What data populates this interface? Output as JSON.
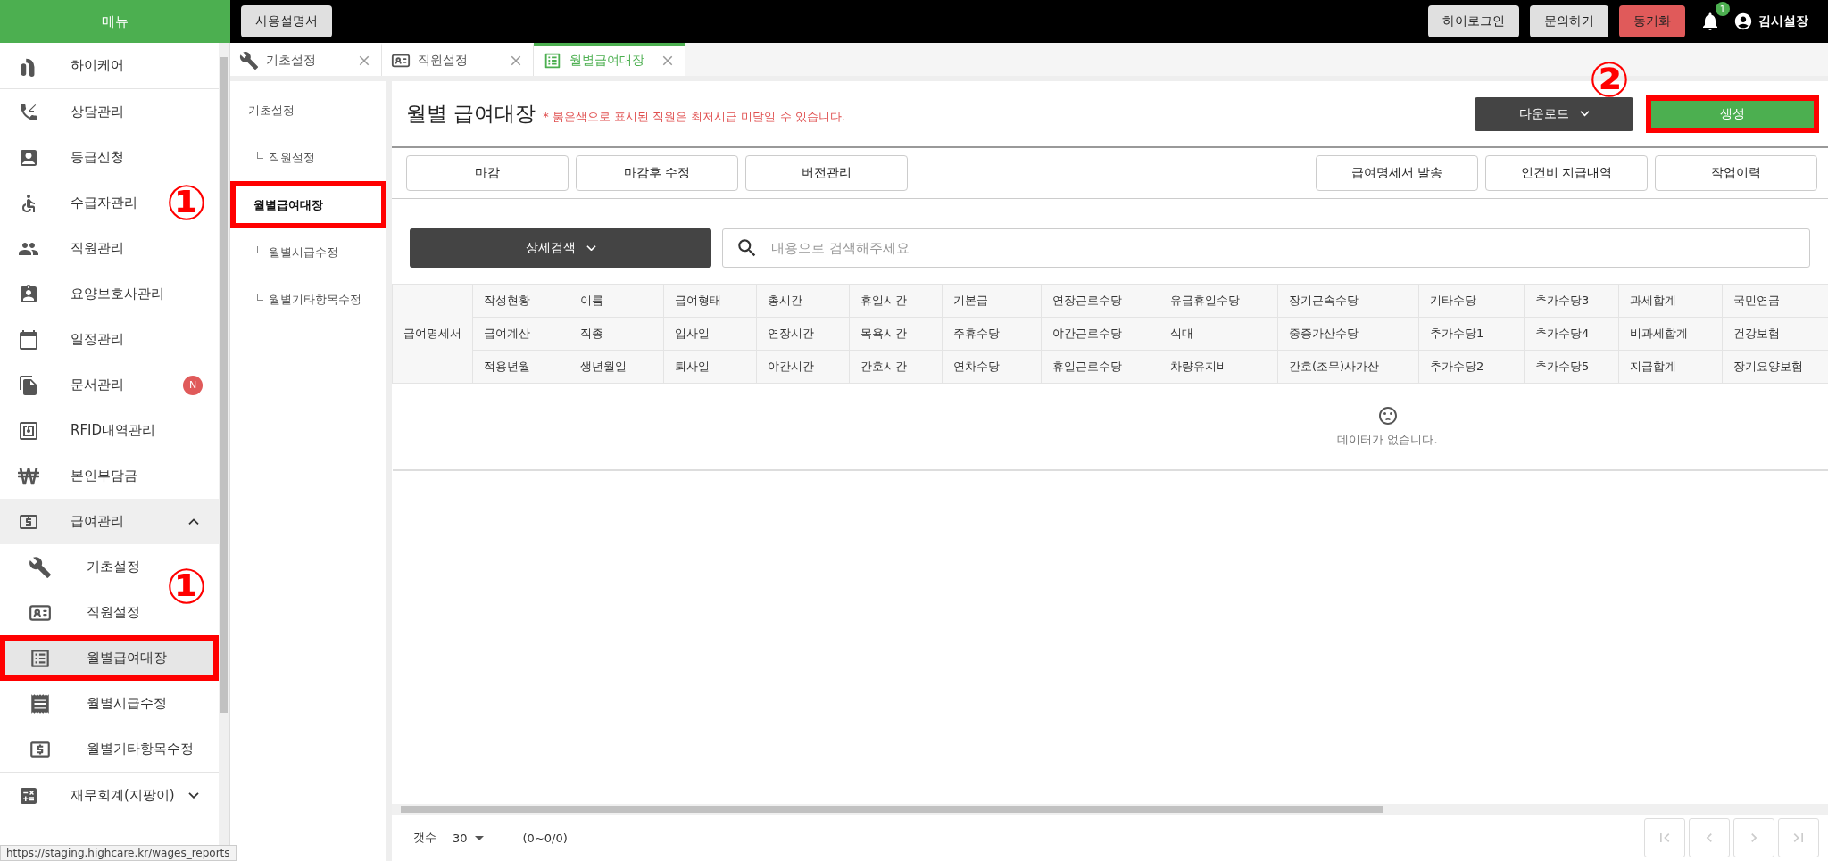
{
  "header": {
    "menu_title": "메뉴",
    "manual_button": "사용설명서",
    "buttons": [
      {
        "label": "하이로그인",
        "kind": "default"
      },
      {
        "label": "문의하기",
        "kind": "default"
      },
      {
        "label": "동기화",
        "kind": "danger"
      }
    ],
    "notification_count": "1",
    "user": "김시설장"
  },
  "sidebar": {
    "items": [
      {
        "label": "하이케어",
        "selected": false
      },
      {
        "label": "상담관리",
        "selected": false
      },
      {
        "label": "등급신청",
        "selected": false
      },
      {
        "label": "수급자관리",
        "selected": false,
        "callout": "①"
      },
      {
        "label": "직원관리",
        "selected": false
      },
      {
        "label": "요양보호사관리",
        "selected": false
      },
      {
        "label": "일정관리",
        "selected": false
      },
      {
        "label": "문서관리",
        "selected": false,
        "badge": "N"
      },
      {
        "label": "RFID내역관리",
        "selected": false
      },
      {
        "label": "본인부담금",
        "selected": false
      },
      {
        "label": "급여관리",
        "selected": false,
        "expanded": true,
        "children": [
          {
            "label": "기초설정",
            "selected": false,
            "callout": "①"
          },
          {
            "label": "직원설정",
            "selected": false
          },
          {
            "label": "월별급여대장",
            "selected": true,
            "annotated": true
          },
          {
            "label": "월별시급수정",
            "selected": false
          },
          {
            "label": "월별기타항목수정",
            "selected": false
          }
        ]
      },
      {
        "label": "재무회계(지팡이)",
        "selected": false,
        "expanded": false
      }
    ]
  },
  "tabs": [
    {
      "label": "기초설정",
      "selected": false
    },
    {
      "label": "직원설정",
      "selected": false
    },
    {
      "label": "월별급여대장",
      "selected": true
    }
  ],
  "subnav": [
    {
      "label": "기초설정",
      "selected": false,
      "children": [
        {
          "label": "직원설정",
          "selected": false
        }
      ]
    },
    {
      "label": "월별급여대장",
      "selected": true,
      "annotated": true,
      "children": [
        {
          "label": "월별시급수정",
          "selected": false
        },
        {
          "label": "월별기타항목수정",
          "selected": false
        }
      ]
    }
  ],
  "page": {
    "title": "월별 급여대장",
    "note": "* 붉은색으로 표시된 직원은 최저시급 미달일 수 있습니다.",
    "download_button": "다운로드",
    "create_button": {
      "label": "생성",
      "annotated": true,
      "callout": "②"
    },
    "left_actions": [
      "마감",
      "마감후 수정",
      "버전관리"
    ],
    "right_actions": [
      "급여명세서 발송",
      "인건비 지급내역",
      "작업이력"
    ],
    "search": {
      "filter_button": "상세검색",
      "placeholder": "내용으로 검색해주세요"
    },
    "table": {
      "row_header": "급여명세서",
      "header_rows": [
        [
          "작성현황",
          "이름",
          "급여형태",
          "총시간",
          "휴일시간",
          "기본급",
          "연장근로수당",
          "유급휴일수당",
          "장기근속수당",
          "기타수당",
          "추가수당3",
          "과세합계",
          "국민연금"
        ],
        [
          "급여계산",
          "직종",
          "입사일",
          "연장시간",
          "목욕시간",
          "주휴수당",
          "야간근로수당",
          "식대",
          "중증가산수당",
          "추가수당1",
          "추가수당4",
          "비과세합계",
          "건강보험"
        ],
        [
          "적용년월",
          "생년월일",
          "퇴사일",
          "야간시간",
          "간호시간",
          "연차수당",
          "휴일근로수당",
          "차량유지비",
          "간호(조무)사가산",
          "추가수당2",
          "추가수당5",
          "지급합계",
          "장기요양보험"
        ]
      ],
      "empty_message": "데이터가 없습니다."
    },
    "footer": {
      "count_label": "갯수",
      "page_size": "30",
      "range": "(0~0/0)",
      "pager": [
        {
          "kind": "first",
          "disabled": true
        },
        {
          "kind": "prev",
          "disabled": true
        },
        {
          "kind": "next",
          "disabled": true
        },
        {
          "kind": "last",
          "disabled": true
        }
      ]
    }
  },
  "status_url": "https://staging.highcare.kr/wages_reports"
}
